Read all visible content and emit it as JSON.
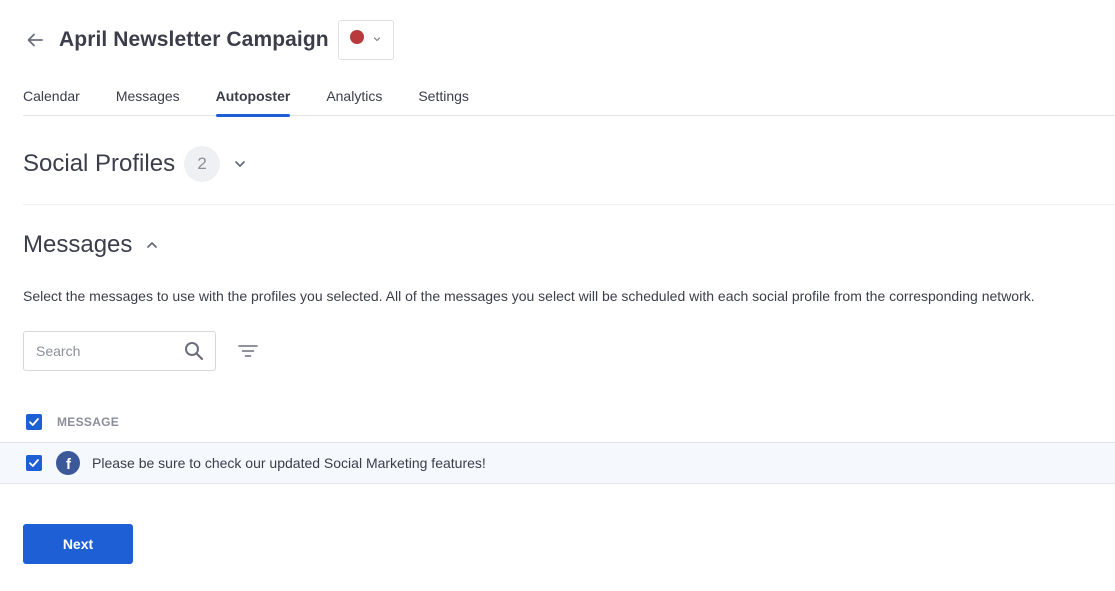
{
  "header": {
    "title": "April Newsletter Campaign",
    "color_swatch": "#b83a3d"
  },
  "tabs": [
    {
      "label": "Calendar",
      "active": false
    },
    {
      "label": "Messages",
      "active": false
    },
    {
      "label": "Autoposter",
      "active": true
    },
    {
      "label": "Analytics",
      "active": false
    },
    {
      "label": "Settings",
      "active": false
    }
  ],
  "profiles_section": {
    "title": "Social Profiles",
    "count": "2"
  },
  "messages_section": {
    "title": "Messages",
    "description": "Select the messages to use with the profiles you selected. All of the messages you select will be scheduled with each social profile from the corresponding network."
  },
  "search": {
    "placeholder": "Search",
    "value": ""
  },
  "table": {
    "column_header": "MESSAGE",
    "select_all_checked": true,
    "rows": [
      {
        "network_icon": "facebook-icon",
        "network_icon_letter": "f",
        "text": "Please be sure to check our updated Social Marketing features!",
        "checked": true
      }
    ]
  },
  "actions": {
    "next_label": "Next"
  },
  "colors": {
    "accent": "#1f5fd6",
    "facebook": "#3b5998",
    "row_highlight": "#f5f8fc"
  }
}
